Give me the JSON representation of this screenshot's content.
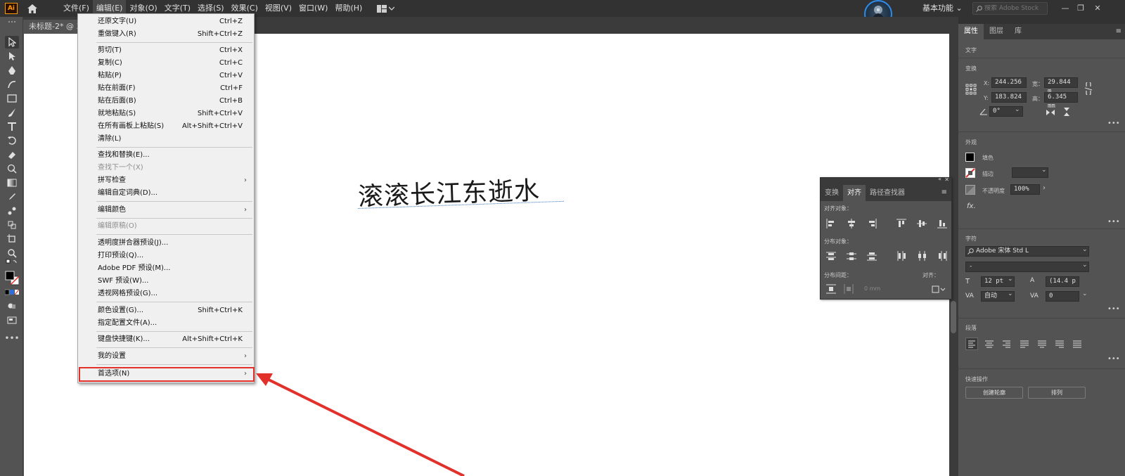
{
  "app": {
    "logo_text": "Ai",
    "menu": [
      "文件(F)",
      "编辑(E)",
      "对象(O)",
      "文字(T)",
      "选择(S)",
      "效果(C)",
      "视图(V)",
      "窗口(W)",
      "帮助(H)"
    ],
    "workspace": "基本功能",
    "stock_search_placeholder": "搜索 Adobe Stock"
  },
  "document": {
    "tab_label": "未标题-2* @ 3"
  },
  "canvas": {
    "text": "滚滚长江东逝水"
  },
  "edit_menu": {
    "items": [
      {
        "label": "还原文字(U)",
        "shortcut": "Ctrl+Z"
      },
      {
        "label": "重做键入(R)",
        "shortcut": "Shift+Ctrl+Z"
      },
      {
        "label": "剪切(T)",
        "shortcut": "Ctrl+X"
      },
      {
        "label": "复制(C)",
        "shortcut": "Ctrl+C"
      },
      {
        "label": "粘贴(P)",
        "shortcut": "Ctrl+V"
      },
      {
        "label": "贴在前面(F)",
        "shortcut": "Ctrl+F"
      },
      {
        "label": "贴在后面(B)",
        "shortcut": "Ctrl+B"
      },
      {
        "label": "就地粘贴(S)",
        "shortcut": "Shift+Ctrl+V"
      },
      {
        "label": "在所有画板上粘贴(S)",
        "shortcut": "Alt+Shift+Ctrl+V"
      },
      {
        "label": "清除(L)",
        "shortcut": ""
      },
      {
        "label": "查找和替换(E)...",
        "shortcut": ""
      },
      {
        "label": "查找下一个(X)",
        "shortcut": ""
      },
      {
        "label": "拼写检查",
        "shortcut": ""
      },
      {
        "label": "编辑自定词典(D)...",
        "shortcut": ""
      },
      {
        "label": "编辑颜色",
        "shortcut": ""
      },
      {
        "label": "编辑原稿(O)",
        "shortcut": ""
      },
      {
        "label": "透明度拼合器预设(J)...",
        "shortcut": ""
      },
      {
        "label": "打印预设(Q)...",
        "shortcut": ""
      },
      {
        "label": "Adobe PDF 预设(M)...",
        "shortcut": ""
      },
      {
        "label": "SWF 预设(W)...",
        "shortcut": ""
      },
      {
        "label": "透视网格预设(G)...",
        "shortcut": ""
      },
      {
        "label": "颜色设置(G)...",
        "shortcut": "Shift+Ctrl+K"
      },
      {
        "label": "指定配置文件(A)...",
        "shortcut": ""
      },
      {
        "label": "键盘快捷键(K)...",
        "shortcut": "Alt+Shift+Ctrl+K"
      },
      {
        "label": "我的设置",
        "shortcut": ""
      },
      {
        "label": "首选项(N)",
        "shortcut": ""
      }
    ]
  },
  "align_panel": {
    "tabs": [
      "变换",
      "对齐",
      "路径查找器"
    ],
    "align_objects_label": "对齐对象：",
    "distribute_objects_label": "分布对象：",
    "distribute_spacing_label": "分布间距：",
    "align_to_label": "对齐：",
    "spacing_value": "0 mm"
  },
  "properties": {
    "tabs": [
      "属性",
      "图层",
      "库"
    ],
    "type_label": "文字",
    "transform_label": "变换",
    "x_label": "X:",
    "x_value": "244.256",
    "y_label": "Y:",
    "y_value": "183.824",
    "w_label": "宽：",
    "w_value": "29.844 m",
    "h_label": "高：",
    "h_value": "6.345 mm",
    "rotate_value": "0°",
    "appearance_label": "外观",
    "fill_label": "填色",
    "stroke_label": "描边",
    "opacity_label": "不透明度",
    "opacity_value": "100%",
    "fx_label": "fx.",
    "character_label": "字符",
    "font_family": "Adobe 宋体 Std L",
    "font_style": "-",
    "font_size": "12 pt",
    "leading": "(14.4 p",
    "kerning": "自动",
    "tracking": "0",
    "paragraph_label": "段落",
    "quick_actions_label": "快速操作",
    "create_outlines_button": "创建轮廓",
    "arrange_button": "排列"
  },
  "colors": {
    "ui_dark": "#323232",
    "ui_panel": "#535353",
    "highlight_red": "#e2302b",
    "accent_blue": "#2d8ceb"
  }
}
